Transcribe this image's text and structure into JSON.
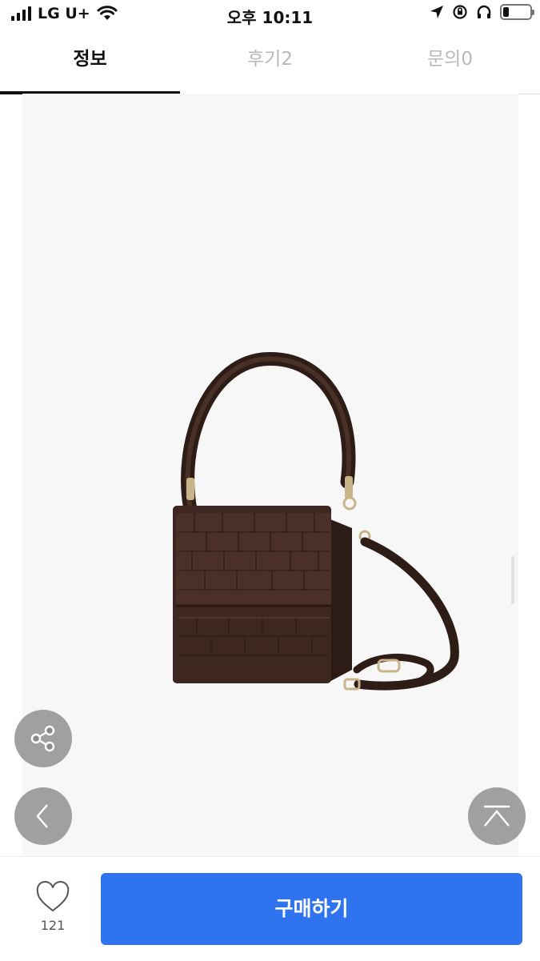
{
  "status_bar": {
    "carrier": "LG U+",
    "time": "오후 10:11",
    "battery_level": 0.2
  },
  "tabs": [
    {
      "label": "정보",
      "active": true
    },
    {
      "label": "후기2",
      "active": false
    },
    {
      "label": "문의0",
      "active": false
    }
  ],
  "product": {
    "image_icon": "brown-croc-handbag-image"
  },
  "floating_buttons": {
    "share_icon": "share-icon",
    "back_icon": "chevron-left-icon",
    "top_icon": "scroll-to-top-icon"
  },
  "bottom_bar": {
    "like_icon": "heart-outline-icon",
    "like_count": "121",
    "buy_label": "구매하기",
    "buy_color": "#2f74ee"
  }
}
